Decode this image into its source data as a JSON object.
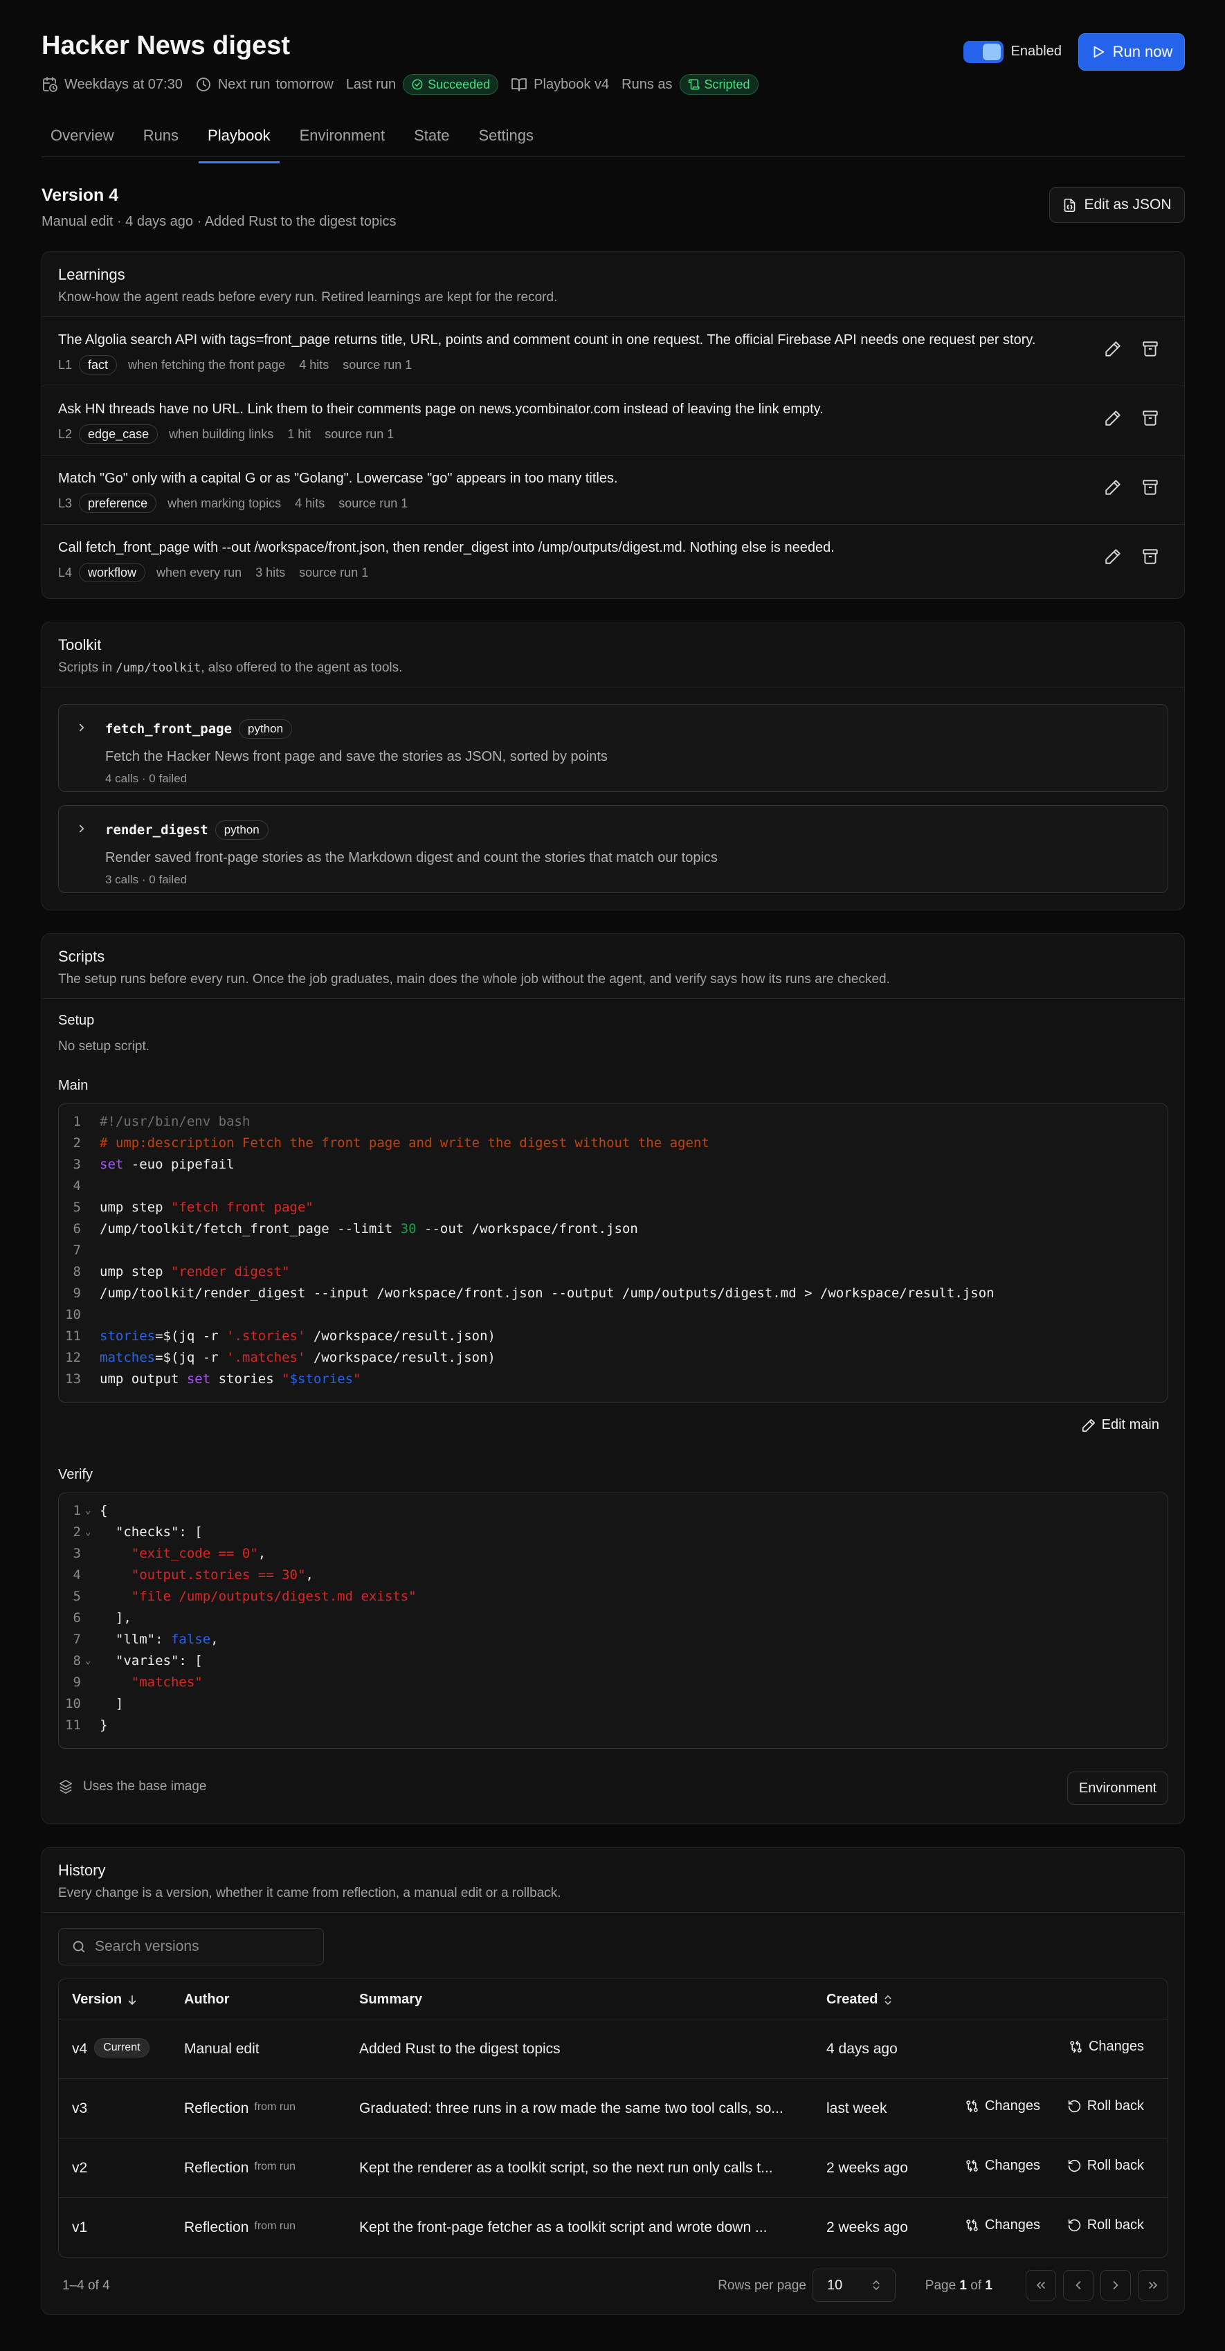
{
  "header": {
    "title": "Hacker News digest",
    "schedule": "Weekdays at 07:30",
    "next_run_label": "Next run",
    "next_run_value": "tomorrow",
    "last_run_label": "Last run",
    "last_run_status": "Succeeded",
    "playbook": "Playbook v4",
    "runs_as_label": "Runs as",
    "runs_as_value": "Scripted",
    "enabled_label": "Enabled",
    "run_now_label": "Run now"
  },
  "tabs": [
    "Overview",
    "Runs",
    "Playbook",
    "Environment",
    "State",
    "Settings"
  ],
  "active_tab": "Playbook",
  "version": {
    "title": "Version 4",
    "subtitle": "Manual edit · 4 days ago · Added Rust to the digest topics",
    "edit_json_label": "Edit as JSON"
  },
  "learnings": {
    "title": "Learnings",
    "description": "Know-how the agent reads before every run. Retired learnings are kept for the record.",
    "items": [
      {
        "id": "L1",
        "text": "The Algolia search API with tags=front_page returns title, URL, points and comment count in one request. The official Firebase API needs one request per story.",
        "tag": "fact",
        "when": "when fetching the front page",
        "hits": "4 hits",
        "source": "source run 1"
      },
      {
        "id": "L2",
        "text": "Ask HN threads have no URL. Link them to their comments page on news.ycombinator.com instead of leaving the link empty.",
        "tag": "edge_case",
        "when": "when building links",
        "hits": "1 hit",
        "source": "source run 1"
      },
      {
        "id": "L3",
        "text": "Match \"Go\" only with a capital G or as \"Golang\". Lowercase \"go\" appears in too many titles.",
        "tag": "preference",
        "when": "when marking topics",
        "hits": "4 hits",
        "source": "source run 1"
      },
      {
        "id": "L4",
        "text": "Call fetch_front_page with --out /workspace/front.json, then render_digest into /ump/outputs/digest.md. Nothing else is needed.",
        "tag": "workflow",
        "when": "when every run",
        "hits": "3 hits",
        "source": "source run 1"
      }
    ]
  },
  "toolkit": {
    "title": "Toolkit",
    "desc_pre": "Scripts in ",
    "desc_code": "/ump/toolkit",
    "desc_post": ", also offered to the agent as tools.",
    "tools": [
      {
        "name": "fetch_front_page",
        "lang": "python",
        "description": "Fetch the Hacker News front page and save the stories as JSON, sorted by points",
        "stats": "4 calls · 0 failed"
      },
      {
        "name": "render_digest",
        "lang": "python",
        "description": "Render saved front-page stories as the Markdown digest and count the stories that match our topics",
        "stats": "3 calls · 0 failed"
      }
    ]
  },
  "scripts": {
    "title": "Scripts",
    "description": "The setup runs before every run. Once the job graduates, main does the whole job without the agent, and verify says how its runs are checked.",
    "setup_label": "Setup",
    "setup_text": "No setup script.",
    "main_label": "Main",
    "main_lines": [
      [
        {
          "t": "#!/usr/bin/env bash",
          "k": "sh"
        }
      ],
      [
        {
          "t": "# ump:description Fetch the front page and write the digest without the agent",
          "k": "cm"
        }
      ],
      [
        {
          "t": "set",
          "k": "kw"
        },
        {
          "t": " -euo pipefail",
          "k": ""
        }
      ],
      [],
      [
        {
          "t": "ump step ",
          "k": ""
        },
        {
          "t": "\"fetch front page\"",
          "k": "st"
        }
      ],
      [
        {
          "t": "/ump/toolkit/fetch_front_page --limit ",
          "k": ""
        },
        {
          "t": "30",
          "k": "nm"
        },
        {
          "t": " --out /workspace/front.json",
          "k": ""
        }
      ],
      [],
      [
        {
          "t": "ump step ",
          "k": ""
        },
        {
          "t": "\"render digest\"",
          "k": "st"
        }
      ],
      [
        {
          "t": "/ump/toolkit/render_digest --input /workspace/front.json --output /ump/outputs/digest.md > /workspace/result.json",
          "k": ""
        }
      ],
      [],
      [
        {
          "t": "stories",
          "k": "vr"
        },
        {
          "t": "=$(jq -r ",
          "k": ""
        },
        {
          "t": "'.stories'",
          "k": "st"
        },
        {
          "t": " /workspace/result.json)",
          "k": ""
        }
      ],
      [
        {
          "t": "matches",
          "k": "vr"
        },
        {
          "t": "=$(jq -r ",
          "k": ""
        },
        {
          "t": "'.matches'",
          "k": "st"
        },
        {
          "t": " /workspace/result.json)",
          "k": ""
        }
      ],
      [
        {
          "t": "ump output ",
          "k": ""
        },
        {
          "t": "set",
          "k": "kw"
        },
        {
          "t": " stories ",
          "k": ""
        },
        {
          "t": "\"",
          "k": "st"
        },
        {
          "t": "$stories",
          "k": "vr"
        },
        {
          "t": "\"",
          "k": "st"
        }
      ]
    ],
    "edit_main_label": "Edit main",
    "verify_label": "Verify",
    "verify_lines": [
      {
        "fold": true,
        "parts": [
          {
            "t": "{",
            "k": ""
          }
        ]
      },
      {
        "fold": true,
        "parts": [
          {
            "t": "  \"checks\": [",
            "k": ""
          }
        ]
      },
      {
        "fold": false,
        "parts": [
          {
            "t": "    ",
            "k": ""
          },
          {
            "t": "\"exit_code == 0\"",
            "k": "st"
          },
          {
            "t": ",",
            "k": ""
          }
        ]
      },
      {
        "fold": false,
        "parts": [
          {
            "t": "    ",
            "k": ""
          },
          {
            "t": "\"output.stories == 30\"",
            "k": "st"
          },
          {
            "t": ",",
            "k": ""
          }
        ]
      },
      {
        "fold": false,
        "parts": [
          {
            "t": "    ",
            "k": ""
          },
          {
            "t": "\"file /ump/outputs/digest.md exists\"",
            "k": "st"
          }
        ]
      },
      {
        "fold": false,
        "parts": [
          {
            "t": "  ],",
            "k": ""
          }
        ]
      },
      {
        "fold": false,
        "parts": [
          {
            "t": "  \"llm\": ",
            "k": ""
          },
          {
            "t": "false",
            "k": "bl"
          },
          {
            "t": ",",
            "k": ""
          }
        ]
      },
      {
        "fold": true,
        "parts": [
          {
            "t": "  \"varies\": [",
            "k": ""
          }
        ]
      },
      {
        "fold": false,
        "parts": [
          {
            "t": "    ",
            "k": ""
          },
          {
            "t": "\"matches\"",
            "k": "st"
          }
        ]
      },
      {
        "fold": false,
        "parts": [
          {
            "t": "  ]",
            "k": ""
          }
        ]
      },
      {
        "fold": false,
        "parts": [
          {
            "t": "}",
            "k": ""
          }
        ]
      }
    ],
    "base_image_text": "Uses the base image",
    "environment_button": "Environment"
  },
  "history": {
    "title": "History",
    "description": "Every change is a version, whether it came from reflection, a manual edit or a rollback.",
    "search_placeholder": "Search versions",
    "columns": {
      "version": "Version",
      "author": "Author",
      "summary": "Summary",
      "created": "Created"
    },
    "current_badge": "Current",
    "from_run_label": "from run",
    "changes_label": "Changes",
    "rollback_label": "Roll back",
    "rows": [
      {
        "version": "v4",
        "author": "Manual edit",
        "summary": "Added Rust to the digest topics",
        "created": "4 days ago",
        "current": true,
        "from_run": false
      },
      {
        "version": "v3",
        "author": "Reflection",
        "summary": "Graduated: three runs in a row made the same two tool calls, so...",
        "created": "last week",
        "current": false,
        "from_run": true
      },
      {
        "version": "v2",
        "author": "Reflection",
        "summary": "Kept the renderer as a toolkit script, so the next run only calls t...",
        "created": "2 weeks ago",
        "current": false,
        "from_run": true
      },
      {
        "version": "v1",
        "author": "Reflection",
        "summary": "Kept the front-page fetcher as a toolkit script and wrote down ...",
        "created": "2 weeks ago",
        "current": false,
        "from_run": true
      }
    ],
    "count_text": "1–4 of 4",
    "rows_per_page_label": "Rows per page",
    "rows_per_page_value": "10",
    "page_prefix": "Page",
    "page_current": "1",
    "page_of": "of",
    "page_total": "1"
  },
  "colors": {
    "accent": "#2563eb",
    "success": "#4ade80",
    "background": "#0a0a0a"
  }
}
